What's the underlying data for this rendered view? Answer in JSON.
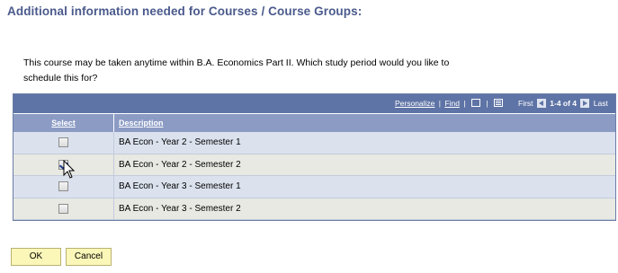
{
  "page": {
    "title": "Additional information needed for Courses / Course Groups:",
    "instructions_line1": "This course may be taken anytime within B.A. Economics Part II.  Which study period would you like to",
    "instructions_line2": "schedule this for?"
  },
  "grid": {
    "nav": {
      "personalize": "Personalize",
      "find": "Find",
      "separator": "|",
      "view_all_icon": "view-all-icon",
      "download_icon": "download-icon",
      "first": "First",
      "count": "1-4 of 4",
      "last": "Last"
    },
    "columns": {
      "select": "Select",
      "description": "Description"
    },
    "rows": [
      {
        "description": "BA Econ - Year 2 - Semester 1",
        "checked": false
      },
      {
        "description": "BA Econ - Year 2 - Semester 2",
        "checked": true
      },
      {
        "description": "BA Econ - Year 3 - Semester 1",
        "checked": false
      },
      {
        "description": "BA Econ - Year 3 - Semester 2",
        "checked": false
      }
    ]
  },
  "buttons": {
    "ok": "OK",
    "cancel": "Cancel"
  },
  "colors": {
    "title": "#4a5a8c",
    "nav_bar": "#5f74a6",
    "header": "#8b9bc4",
    "row_even": "#dbe2ee",
    "row_odd": "#e7e9e2",
    "button": "#fbf7b8"
  }
}
